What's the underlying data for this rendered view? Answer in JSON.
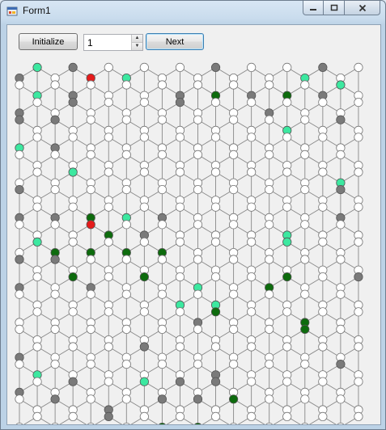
{
  "window": {
    "title": "Form1"
  },
  "toolbar": {
    "initialize_label": "Initialize",
    "step_value": "1",
    "next_label": "Next"
  },
  "colors": {
    "empty": "#ffffff",
    "gray": "#7a7a7a",
    "light_green": "#3ce8a0",
    "dark_green": "#0d6b0d",
    "red": "#e51b1b",
    "edge": "#888888"
  },
  "board": {
    "rows": 21,
    "columns": 20,
    "cells": [
      "GLEGRELEEEEGEEEELGEE",
      "ELEGEEEEEGEDEGEDEGLE",
      "GEEGEEEEEGEEEEGEEEEE",
      "GEGEEEEEEEEEEEELEEGE",
      "LEGEEEEEEEEEEEEEEEEE",
      "EEEEEEEEEEEEEEEEEEEE",
      "EEELEEEEEEEEEEEEEELE",
      "GEEEEEEEEEEEEEEEEEGE",
      "GEGEDELEGEEEEEEEEEGE",
      "EEEERDEGEEEEEEELEEEE",
      "ELDEDEDEDEEEEEELEEEE",
      "GEGEEEEEEEEEEEEEEEEE",
      "GEEDGEEDEELEEEDDEEEG",
      "EEEEEEEEELELEEEEEEEE",
      "EEEEEEEEEEGDEEEEDEEE",
      "EEEEEEEEEEEEEEEEDEEE",
      "GEEEEEEGEEEEEEEEEEEE",
      "ELEEEEEEEEEGEEEEEEGE",
      "GEEGEEELEGEGEEEEEEEE",
      "EEGEEGEEGEGEDEEEEEEE",
      "EEEEEGEEDEDEEEEEEEEE"
    ]
  }
}
